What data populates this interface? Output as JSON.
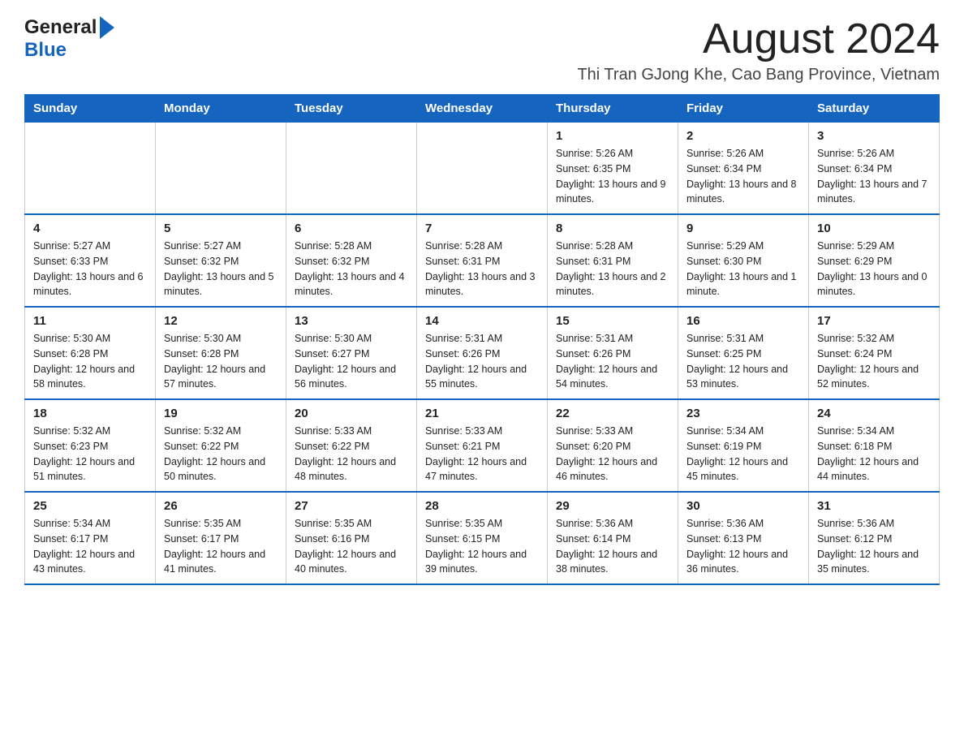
{
  "header": {
    "logo_general": "General",
    "logo_blue": "Blue",
    "main_title": "August 2024",
    "subtitle": "Thi Tran GJong Khe, Cao Bang Province, Vietnam"
  },
  "calendar": {
    "days_of_week": [
      "Sunday",
      "Monday",
      "Tuesday",
      "Wednesday",
      "Thursday",
      "Friday",
      "Saturday"
    ],
    "weeks": [
      [
        {
          "day": "",
          "info": ""
        },
        {
          "day": "",
          "info": ""
        },
        {
          "day": "",
          "info": ""
        },
        {
          "day": "",
          "info": ""
        },
        {
          "day": "1",
          "info": "Sunrise: 5:26 AM\nSunset: 6:35 PM\nDaylight: 13 hours and 9 minutes."
        },
        {
          "day": "2",
          "info": "Sunrise: 5:26 AM\nSunset: 6:34 PM\nDaylight: 13 hours and 8 minutes."
        },
        {
          "day": "3",
          "info": "Sunrise: 5:26 AM\nSunset: 6:34 PM\nDaylight: 13 hours and 7 minutes."
        }
      ],
      [
        {
          "day": "4",
          "info": "Sunrise: 5:27 AM\nSunset: 6:33 PM\nDaylight: 13 hours and 6 minutes."
        },
        {
          "day": "5",
          "info": "Sunrise: 5:27 AM\nSunset: 6:32 PM\nDaylight: 13 hours and 5 minutes."
        },
        {
          "day": "6",
          "info": "Sunrise: 5:28 AM\nSunset: 6:32 PM\nDaylight: 13 hours and 4 minutes."
        },
        {
          "day": "7",
          "info": "Sunrise: 5:28 AM\nSunset: 6:31 PM\nDaylight: 13 hours and 3 minutes."
        },
        {
          "day": "8",
          "info": "Sunrise: 5:28 AM\nSunset: 6:31 PM\nDaylight: 13 hours and 2 minutes."
        },
        {
          "day": "9",
          "info": "Sunrise: 5:29 AM\nSunset: 6:30 PM\nDaylight: 13 hours and 1 minute."
        },
        {
          "day": "10",
          "info": "Sunrise: 5:29 AM\nSunset: 6:29 PM\nDaylight: 13 hours and 0 minutes."
        }
      ],
      [
        {
          "day": "11",
          "info": "Sunrise: 5:30 AM\nSunset: 6:28 PM\nDaylight: 12 hours and 58 minutes."
        },
        {
          "day": "12",
          "info": "Sunrise: 5:30 AM\nSunset: 6:28 PM\nDaylight: 12 hours and 57 minutes."
        },
        {
          "day": "13",
          "info": "Sunrise: 5:30 AM\nSunset: 6:27 PM\nDaylight: 12 hours and 56 minutes."
        },
        {
          "day": "14",
          "info": "Sunrise: 5:31 AM\nSunset: 6:26 PM\nDaylight: 12 hours and 55 minutes."
        },
        {
          "day": "15",
          "info": "Sunrise: 5:31 AM\nSunset: 6:26 PM\nDaylight: 12 hours and 54 minutes."
        },
        {
          "day": "16",
          "info": "Sunrise: 5:31 AM\nSunset: 6:25 PM\nDaylight: 12 hours and 53 minutes."
        },
        {
          "day": "17",
          "info": "Sunrise: 5:32 AM\nSunset: 6:24 PM\nDaylight: 12 hours and 52 minutes."
        }
      ],
      [
        {
          "day": "18",
          "info": "Sunrise: 5:32 AM\nSunset: 6:23 PM\nDaylight: 12 hours and 51 minutes."
        },
        {
          "day": "19",
          "info": "Sunrise: 5:32 AM\nSunset: 6:22 PM\nDaylight: 12 hours and 50 minutes."
        },
        {
          "day": "20",
          "info": "Sunrise: 5:33 AM\nSunset: 6:22 PM\nDaylight: 12 hours and 48 minutes."
        },
        {
          "day": "21",
          "info": "Sunrise: 5:33 AM\nSunset: 6:21 PM\nDaylight: 12 hours and 47 minutes."
        },
        {
          "day": "22",
          "info": "Sunrise: 5:33 AM\nSunset: 6:20 PM\nDaylight: 12 hours and 46 minutes."
        },
        {
          "day": "23",
          "info": "Sunrise: 5:34 AM\nSunset: 6:19 PM\nDaylight: 12 hours and 45 minutes."
        },
        {
          "day": "24",
          "info": "Sunrise: 5:34 AM\nSunset: 6:18 PM\nDaylight: 12 hours and 44 minutes."
        }
      ],
      [
        {
          "day": "25",
          "info": "Sunrise: 5:34 AM\nSunset: 6:17 PM\nDaylight: 12 hours and 43 minutes."
        },
        {
          "day": "26",
          "info": "Sunrise: 5:35 AM\nSunset: 6:17 PM\nDaylight: 12 hours and 41 minutes."
        },
        {
          "day": "27",
          "info": "Sunrise: 5:35 AM\nSunset: 6:16 PM\nDaylight: 12 hours and 40 minutes."
        },
        {
          "day": "28",
          "info": "Sunrise: 5:35 AM\nSunset: 6:15 PM\nDaylight: 12 hours and 39 minutes."
        },
        {
          "day": "29",
          "info": "Sunrise: 5:36 AM\nSunset: 6:14 PM\nDaylight: 12 hours and 38 minutes."
        },
        {
          "day": "30",
          "info": "Sunrise: 5:36 AM\nSunset: 6:13 PM\nDaylight: 12 hours and 36 minutes."
        },
        {
          "day": "31",
          "info": "Sunrise: 5:36 AM\nSunset: 6:12 PM\nDaylight: 12 hours and 35 minutes."
        }
      ]
    ]
  }
}
